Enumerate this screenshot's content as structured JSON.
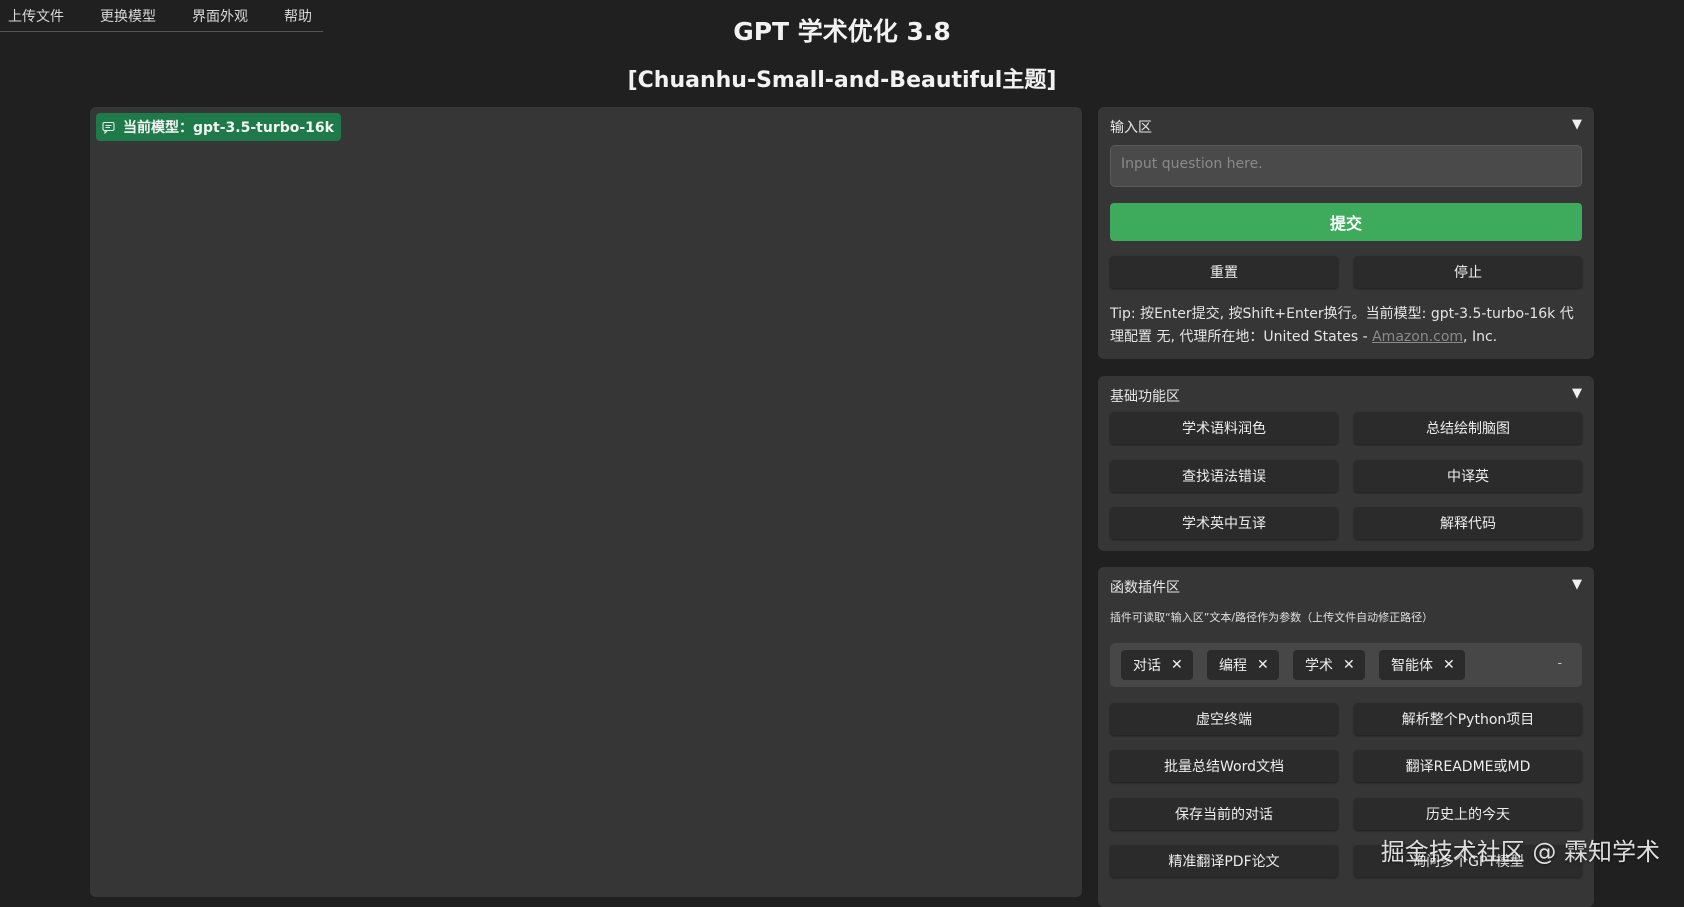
{
  "menu": {
    "items": [
      "上传文件",
      "更换模型",
      "界面外观",
      "帮助"
    ]
  },
  "header": {
    "title": "GPT 学术优化 3.8",
    "subtitle": "[Chuanhu-Small-and-Beautiful主题]"
  },
  "chat": {
    "model_badge": "当前模型：gpt-3.5-turbo-16k"
  },
  "input_card": {
    "title": "输入区",
    "placeholder": "Input question here.",
    "submit_label": "提交",
    "reset_label": "重置",
    "stop_label": "停止",
    "tip_text": "Tip: 按Enter提交, 按Shift+Enter换行。当前模型: gpt-3.5-turbo-16k 代理配置 无, 代理所在地：United States - ",
    "tip_link": "Amazon.com",
    "tip_suffix": ", Inc."
  },
  "basic_card": {
    "title": "基础功能区",
    "buttons": [
      "学术语料润色",
      "总结绘制脑图",
      "查找语法错误",
      "中译英",
      "学术英中互译",
      "解释代码"
    ]
  },
  "plugin_card": {
    "title": "函数插件区",
    "note": "插件可读取“输入区”文本/路径作为参数（上传文件自动修正路径）",
    "tags": [
      "对话",
      "编程",
      "学术",
      "智能体"
    ],
    "tag_remove_glyph": "✕",
    "dropdown_glyph": "-",
    "buttons": [
      "虚空终端",
      "解析整个Python项目",
      "批量总结Word文档",
      "翻译README或MD",
      "保存当前的对话",
      "历史上的今天",
      "精准翻译PDF论文",
      "询问多个GPT模型"
    ]
  },
  "caret_glyph": "▼",
  "watermark": "掘金技术社区 @ 霖知学术",
  "colors": {
    "background": "#202020",
    "panel": "#363636",
    "accent_green": "#3eab5c",
    "badge_green": "#1f7a4a"
  }
}
